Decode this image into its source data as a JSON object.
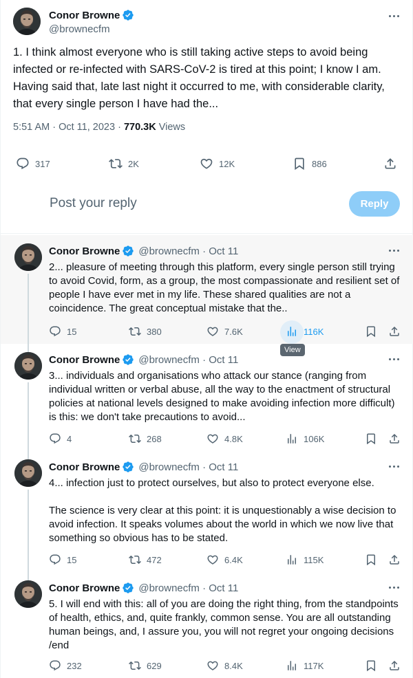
{
  "main_tweet": {
    "author_name": "Conor Browne",
    "handle": "@brownecfm",
    "text": "1. I think almost everyone who is still taking active steps to avoid being infected or re-infected with SARS-CoV-2 is tired at this point; I know I am. Having said that, late last night it occurred to me, with considerable clarity, that every single person I have had the...",
    "time": "5:51 AM · Oct 11, 2023 · ",
    "views_count": "770.3K",
    "views_label": " Views",
    "replies": "317",
    "reposts": "2K",
    "likes": "12K",
    "bookmarks": "886"
  },
  "compose": {
    "placeholder": "Post your reply",
    "button_label": "Reply"
  },
  "thread": [
    {
      "author_name": "Conor Browne",
      "handle": "@brownecfm · Oct 11",
      "text": "2... pleasure of meeting through this platform, every single person still trying to avoid Covid, form, as a group, the most compassionate and resilient set of people I have ever met in my life. These shared qualities are not a coincidence. The great conceptual mistake that the..",
      "replies": "15",
      "reposts": "380",
      "likes": "7.6K",
      "views": "116K",
      "tooltip": "View"
    },
    {
      "author_name": "Conor Browne",
      "handle": "@brownecfm · Oct 11",
      "text": "3... individuals and organisations who attack our stance (ranging from individual written or verbal abuse, all the way to the enactment of structural policies at national levels designed to make avoiding infection more difficult) is this: we don't take precautions to avoid...",
      "replies": "4",
      "reposts": "268",
      "likes": "4.8K",
      "views": "106K"
    },
    {
      "author_name": "Conor Browne",
      "handle": "@brownecfm · Oct 11",
      "text": "4... infection just to protect ourselves, but also to protect everyone else.\n\nThe science is very clear at this point: it is unquestionably a wise decision to avoid infection. It speaks volumes about the world in which we now live that something so obvious has to be stated.",
      "replies": "15",
      "reposts": "472",
      "likes": "6.4K",
      "views": "115K"
    },
    {
      "author_name": "Conor Browne",
      "handle": "@brownecfm · Oct 11",
      "text": "5. I will end with this: all of you are doing the right thing, from the standpoints of health, ethics, and, quite frankly, common sense. You are all outstanding human beings, and, I assure you, you will not regret your ongoing decisions /end",
      "replies": "232",
      "reposts": "629",
      "likes": "8.4K",
      "views": "117K"
    }
  ],
  "colors": {
    "accent": "#1d9bf0",
    "reply_button": "#8ecdf8",
    "secondary_text": "#536471",
    "hover_row": "#f7f7f7"
  },
  "icons": [
    "verified-badge-icon",
    "more-icon",
    "reply-icon",
    "repost-icon",
    "like-icon",
    "bookmark-icon",
    "share-icon",
    "views-icon"
  ]
}
